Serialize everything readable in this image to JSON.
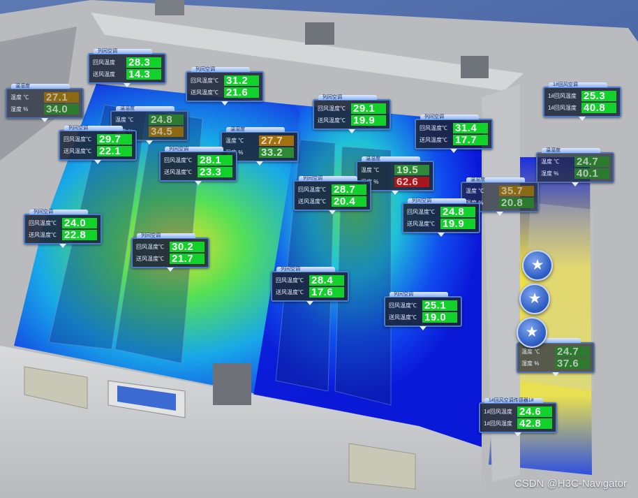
{
  "tags": [
    {
      "id": "t1",
      "label": "列间空调",
      "rows": [
        {
          "name": "回风温度",
          "value": "28.3",
          "state": "ok"
        },
        {
          "name": "送风温度",
          "value": "14.3",
          "state": "ok"
        }
      ]
    },
    {
      "id": "t2",
      "label": "列间空调",
      "rows": [
        {
          "name": "回风温度℃",
          "value": "31.2",
          "state": "ok"
        },
        {
          "name": "送风温度℃",
          "value": "21.6",
          "state": "ok"
        }
      ]
    },
    {
      "id": "t3",
      "label": "温湿度",
      "rows": [
        {
          "name": "温度 ℃",
          "value": "27.1",
          "state": "muted-warn"
        },
        {
          "name": "湿度 %",
          "value": "34.0",
          "state": "muted"
        }
      ]
    },
    {
      "id": "t4",
      "label": "温湿度",
      "rows": [
        {
          "name": "温度 ℃",
          "value": "24.8",
          "state": "muted"
        },
        {
          "name": "湿度 %",
          "value": "34.5",
          "state": "muted-warn"
        }
      ]
    },
    {
      "id": "t5",
      "label": "列间空调",
      "rows": [
        {
          "name": "回风温度℃",
          "value": "29.7",
          "state": "ok"
        },
        {
          "name": "送风温度℃",
          "value": "22.1",
          "state": "ok"
        }
      ]
    },
    {
      "id": "t6",
      "label": "温湿度",
      "rows": [
        {
          "name": "温度 ℃",
          "value": "27.7",
          "state": "warn"
        },
        {
          "name": "湿度 %",
          "value": "33.2",
          "state": "dark"
        }
      ]
    },
    {
      "id": "t7",
      "label": "列间空调",
      "rows": [
        {
          "name": "回风温度℃",
          "value": "28.1",
          "state": "ok"
        },
        {
          "name": "送风温度℃",
          "value": "23.3",
          "state": "ok"
        }
      ]
    },
    {
      "id": "t8",
      "label": "列间空调",
      "rows": [
        {
          "name": "回风温度℃",
          "value": "29.1",
          "state": "ok"
        },
        {
          "name": "送风温度℃",
          "value": "19.9",
          "state": "ok"
        }
      ]
    },
    {
      "id": "t9",
      "label": "列间空调",
      "rows": [
        {
          "name": "回风温度℃",
          "value": "31.4",
          "state": "ok"
        },
        {
          "name": "送风温度℃",
          "value": "17.7",
          "state": "ok"
        }
      ]
    },
    {
      "id": "t10",
      "label": "1#回风空调",
      "rows": [
        {
          "name": "1#回风温度",
          "value": "25.3",
          "state": "ok"
        },
        {
          "name": "1#回风湿度",
          "value": "40.8",
          "state": "ok"
        }
      ]
    },
    {
      "id": "t11",
      "label": "温湿度",
      "rows": [
        {
          "name": "温度 ℃",
          "value": "19.5",
          "state": "dark"
        },
        {
          "name": "湿度 %",
          "value": "62.6",
          "state": "alarm"
        }
      ]
    },
    {
      "id": "t12",
      "label": "温湿度",
      "rows": [
        {
          "name": "温度 ℃",
          "value": "24.7",
          "state": "muted"
        },
        {
          "name": "湿度 %",
          "value": "40.1",
          "state": "muted"
        }
      ]
    },
    {
      "id": "t13",
      "label": "列间空调",
      "rows": [
        {
          "name": "回风温度℃",
          "value": "28.7",
          "state": "ok"
        },
        {
          "name": "送风温度℃",
          "value": "20.4",
          "state": "ok"
        }
      ]
    },
    {
      "id": "t14",
      "label": "温湿度",
      "rows": [
        {
          "name": "温度 ℃",
          "value": "35.7",
          "state": "muted-warn"
        },
        {
          "name": "湿度 %",
          "value": "20.8",
          "state": "muted"
        }
      ]
    },
    {
      "id": "t15",
      "label": "列间空调",
      "rows": [
        {
          "name": "回风温度℃",
          "value": "24.0",
          "state": "ok"
        },
        {
          "name": "送风温度℃",
          "value": "22.8",
          "state": "ok"
        }
      ]
    },
    {
      "id": "t16",
      "label": "列间空调",
      "rows": [
        {
          "name": "回风温度℃",
          "value": "24.8",
          "state": "ok"
        },
        {
          "name": "送风温度℃",
          "value": "19.9",
          "state": "ok"
        }
      ]
    },
    {
      "id": "t17",
      "label": "列间空调",
      "rows": [
        {
          "name": "回风温度℃",
          "value": "30.2",
          "state": "ok"
        },
        {
          "name": "送风温度℃",
          "value": "21.7",
          "state": "ok"
        }
      ]
    },
    {
      "id": "t18",
      "label": "列间空调",
      "rows": [
        {
          "name": "回风温度℃",
          "value": "28.4",
          "state": "ok"
        },
        {
          "name": "送风温度℃",
          "value": "17.6",
          "state": "ok"
        }
      ]
    },
    {
      "id": "t19",
      "label": "列间空调",
      "rows": [
        {
          "name": "回风温度℃",
          "value": "25.1",
          "state": "ok"
        },
        {
          "name": "送风温度℃",
          "value": "19.0",
          "state": "ok"
        }
      ]
    },
    {
      "id": "t20",
      "label": "温湿度",
      "rows": [
        {
          "name": "温度 ℃",
          "value": "24.7",
          "state": "muted"
        },
        {
          "name": "湿度 %",
          "value": "37.6",
          "state": "muted"
        }
      ]
    },
    {
      "id": "t21",
      "label": "1#回风空调传感器1#",
      "rows": [
        {
          "name": "1#回风温度",
          "value": "24.6",
          "state": "ok"
        },
        {
          "name": "1#回风湿度",
          "value": "42.8",
          "state": "ok"
        }
      ]
    }
  ],
  "markers": [
    {
      "icon": "star-icon",
      "glyph": "★"
    },
    {
      "icon": "star-icon",
      "glyph": "★"
    },
    {
      "icon": "star-icon",
      "glyph": "★"
    }
  ],
  "watermark": "CSDN @H3C-Navigator",
  "colors": {
    "ok": "#12d12a",
    "warn": "#a2700e",
    "alarm": "#a7171c",
    "border": "#4a7bd0"
  }
}
